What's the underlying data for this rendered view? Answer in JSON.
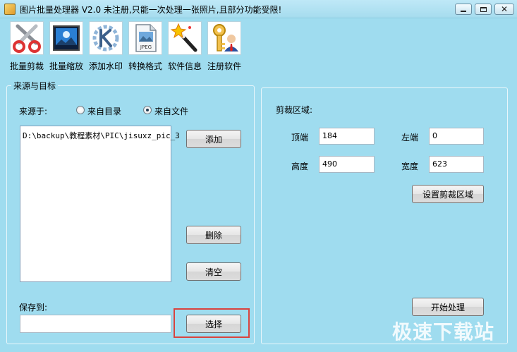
{
  "window": {
    "title": "图片批量处理器 V2.0   未注册,只能一次处理一张照片,且部分功能受限!"
  },
  "toolbar": {
    "items": [
      {
        "label": "批量剪裁",
        "icon": "scissors-icon"
      },
      {
        "label": "批量缩放",
        "icon": "image-resize-icon"
      },
      {
        "label": "添加水印",
        "icon": "watermark-icon"
      },
      {
        "label": "转换格式",
        "icon": "jpeg-file-icon"
      },
      {
        "label": "软件信息",
        "icon": "magic-wand-icon"
      },
      {
        "label": "注册软件",
        "icon": "key-user-icon"
      }
    ]
  },
  "source": {
    "group_title": "来源与目标",
    "source_label": "来源于:",
    "radio_dir_label": "来自目录",
    "radio_file_label": "来自文件",
    "selected": "来自文件",
    "files": [
      "D:\\backup\\教程素材\\PIC\\jisuxz_pic_3"
    ],
    "add_label": "添加",
    "delete_label": "删除",
    "clear_label": "清空",
    "save_label": "保存到:",
    "save_value": "",
    "select_label": "选择"
  },
  "crop": {
    "title": "剪裁区域:",
    "top_label": "顶端",
    "top_value": "184",
    "left_label": "左端",
    "left_value": "0",
    "height_label": "高度",
    "height_value": "490",
    "width_label": "宽度",
    "width_value": "623",
    "set_area_label": "设置剪裁区域",
    "start_label": "开始处理"
  },
  "watermark_text": "极速下载站",
  "colors": {
    "background": "#9fdcef",
    "highlight": "#d9443f"
  }
}
